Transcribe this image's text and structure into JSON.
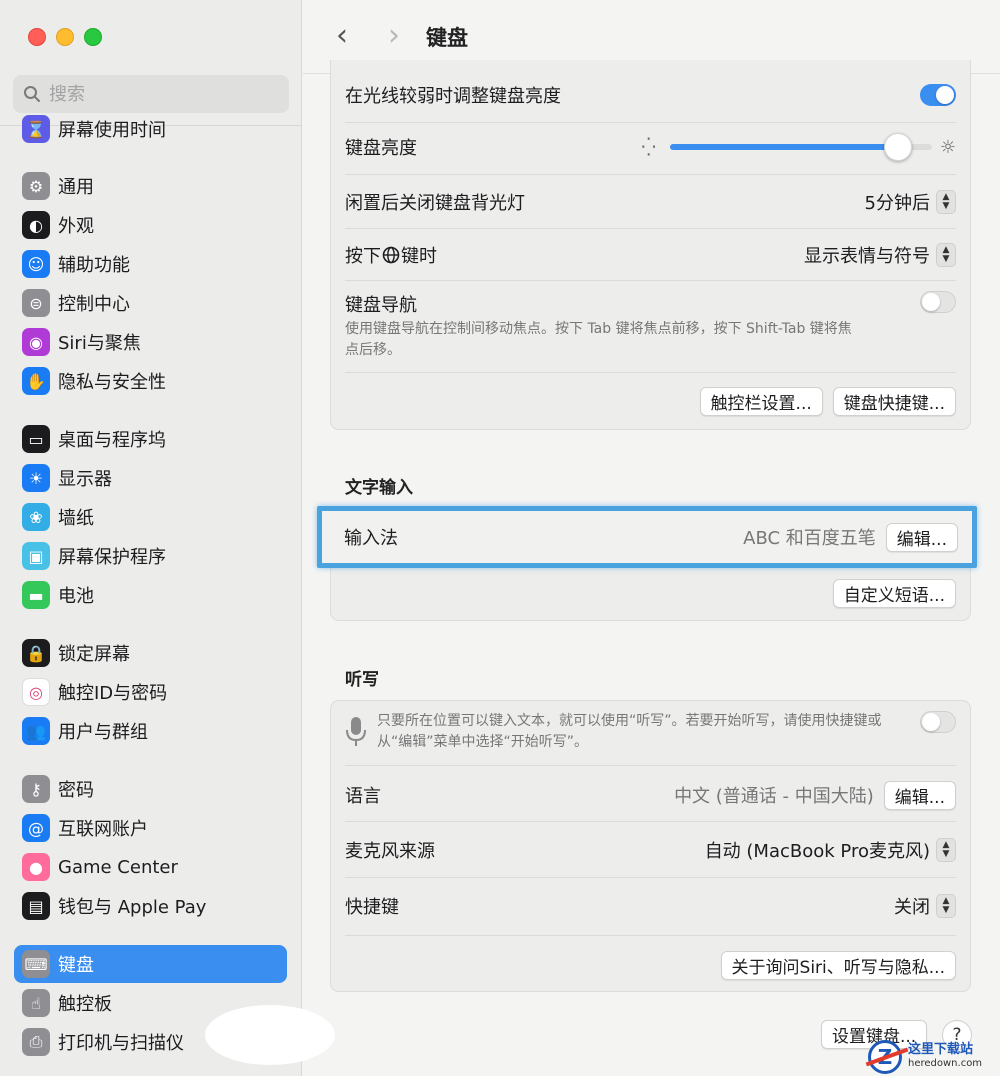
{
  "window": {
    "page_title": "键盘",
    "nav_back": "‹",
    "nav_forward": "›"
  },
  "sidebar": {
    "search_placeholder": "搜索",
    "items": [
      {
        "label": "屏幕使用时间",
        "icon": "hourglass-icon",
        "color": "#5e5ce6",
        "glyph": "⌛"
      },
      {
        "label": "通用",
        "icon": "gear-icon",
        "color": "#8e8e93",
        "glyph": "⚙"
      },
      {
        "label": "外观",
        "icon": "appearance-icon",
        "color": "#1c1c1e",
        "glyph": "◐"
      },
      {
        "label": "辅助功能",
        "icon": "accessibility-icon",
        "color": "#1a7cf5",
        "glyph": "☺"
      },
      {
        "label": "控制中心",
        "icon": "control-center-icon",
        "color": "#8e8e93",
        "glyph": "⊜"
      },
      {
        "label": "Siri与聚焦",
        "icon": "siri-icon",
        "color": "#b03ad6",
        "glyph": "◉"
      },
      {
        "label": "隐私与安全性",
        "icon": "hand-icon",
        "color": "#1a7cf5",
        "glyph": "✋"
      },
      {
        "label": "桌面与程序坞",
        "icon": "dock-icon",
        "color": "#1c1c1e",
        "glyph": "▭"
      },
      {
        "label": "显示器",
        "icon": "sun-icon",
        "color": "#1a7cf5",
        "glyph": "☀"
      },
      {
        "label": "墙纸",
        "icon": "flower-icon",
        "color": "#32ade6",
        "glyph": "❀"
      },
      {
        "label": "屏幕保护程序",
        "icon": "screensaver-icon",
        "color": "#48c1e6",
        "glyph": "▣"
      },
      {
        "label": "电池",
        "icon": "battery-icon",
        "color": "#34c759",
        "glyph": "▬"
      },
      {
        "label": "锁定屏幕",
        "icon": "lock-icon",
        "color": "#1c1c1e",
        "glyph": "🔒"
      },
      {
        "label": "触控ID与密码",
        "icon": "fingerprint-icon",
        "color": "#ffffff",
        "glyph": "◎"
      },
      {
        "label": "用户与群组",
        "icon": "users-icon",
        "color": "#1a7cf5",
        "glyph": "👥"
      },
      {
        "label": "密码",
        "icon": "key-icon",
        "color": "#8e8e93",
        "glyph": "⚷"
      },
      {
        "label": "互联网账户",
        "icon": "at-icon",
        "color": "#1a7cf5",
        "glyph": "@"
      },
      {
        "label": "Game Center",
        "icon": "game-center-icon",
        "color": "#ff6b9a",
        "glyph": "●"
      },
      {
        "label": "钱包与 Apple Pay",
        "icon": "wallet-icon",
        "color": "#1c1c1e",
        "glyph": "▤"
      },
      {
        "label": "键盘",
        "icon": "keyboard-icon",
        "color": "#8e8e93",
        "glyph": "⌨"
      },
      {
        "label": "触控板",
        "icon": "trackpad-icon",
        "color": "#8e8e93",
        "glyph": "☝"
      },
      {
        "label": "打印机与扫描仪",
        "icon": "printer-icon",
        "color": "#8e8e93",
        "glyph": "⎙"
      }
    ]
  },
  "keyboard": {
    "adjust_brightness_label": "在光线较弱时调整键盘亮度",
    "adjust_brightness_on": true,
    "brightness_label": "键盘亮度",
    "brightness_level": 0.87,
    "backlight_off_label": "闲置后关闭键盘背光灯",
    "backlight_off_value": "5分钟后",
    "press_globe_label_pre": "按下",
    "press_globe_label_post": "键时",
    "press_globe_value": "显示表情与符号",
    "keyboard_nav_label": "键盘导航",
    "keyboard_nav_desc": "使用键盘导航在控制间移动焦点。按下 Tab 键将焦点前移，按下 Shift-Tab 键将焦点后移。",
    "keyboard_nav_on": false,
    "touchbar_button": "触控栏设置...",
    "shortcuts_button": "键盘快捷键..."
  },
  "text_input": {
    "section_title": "文字输入",
    "input_method_label": "输入法",
    "input_method_value": "ABC 和百度五笔",
    "edit_button": "编辑...",
    "custom_phrases_button": "自定义短语..."
  },
  "dictation": {
    "section_title": "听写",
    "desc": "只要所在位置可以键入文本，就可以使用“听写”。若要开始听写，请使用快捷键或从“编辑”菜单中选择“开始听写”。",
    "dictation_on": false,
    "language_label": "语言",
    "language_value": "中文 (普通话 - 中国大陆)",
    "language_edit_button": "编辑...",
    "mic_label": "麦克风来源",
    "mic_value": "自动 (MacBook Pro麦克风)",
    "shortcut_label": "快捷键",
    "shortcut_value": "关闭",
    "about_button": "关于询问Siri、听写与隐私..."
  },
  "footer": {
    "setup_keyboard_button": "设置键盘...",
    "help_button": "?"
  },
  "watermark": {
    "logo_letter": "Z",
    "text_cn": "这里下载站",
    "text_en": "heredown.com"
  },
  "colors": {
    "accent": "#3a8ef0",
    "highlight_border": "#4aa3de"
  }
}
